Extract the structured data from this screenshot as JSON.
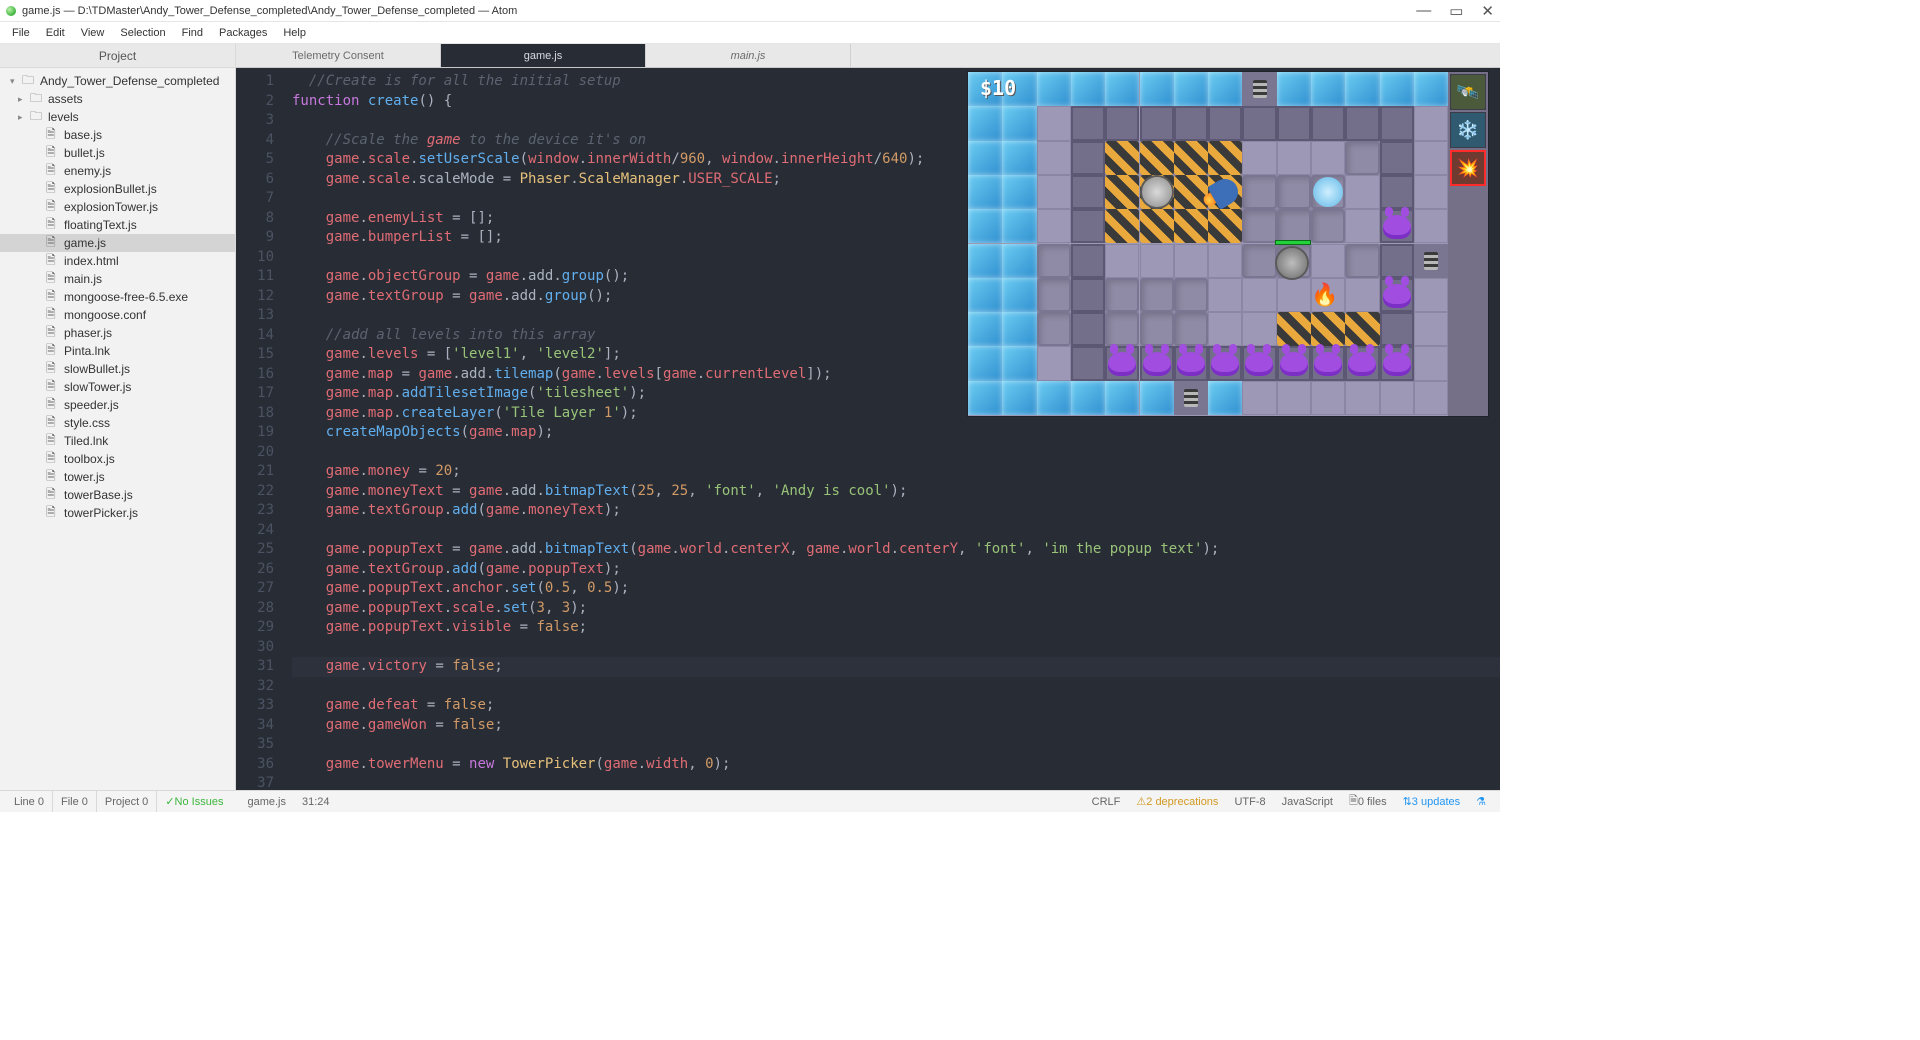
{
  "window": {
    "title": "game.js — D:\\TDMaster\\Andy_Tower_Defense_completed\\Andy_Tower_Defense_completed — Atom"
  },
  "menu": [
    "File",
    "Edit",
    "View",
    "Selection",
    "Find",
    "Packages",
    "Help"
  ],
  "window_controls": {
    "min": "—",
    "max": "▭",
    "close": "✕"
  },
  "sidebar": {
    "title": "Project",
    "root": "Andy_Tower_Defense_completed",
    "folders": [
      "assets",
      "levels"
    ],
    "files": [
      "base.js",
      "bullet.js",
      "enemy.js",
      "explosionBullet.js",
      "explosionTower.js",
      "floatingText.js",
      "game.js",
      "index.html",
      "main.js",
      "mongoose-free-6.5.exe",
      "mongoose.conf",
      "phaser.js",
      "Pinta.lnk",
      "slowBullet.js",
      "slowTower.js",
      "speeder.js",
      "style.css",
      "Tiled.lnk",
      "toolbox.js",
      "tower.js",
      "towerBase.js",
      "towerPicker.js"
    ],
    "selected": "game.js"
  },
  "tabs": [
    {
      "label": "Telemetry Consent",
      "active": false,
      "italic": false
    },
    {
      "label": "game.js",
      "active": true,
      "italic": false
    },
    {
      "label": "main.js",
      "active": false,
      "italic": true
    }
  ],
  "editor": {
    "first_line": 1,
    "highlighted_line": 31,
    "cursor": "31:24"
  },
  "status": {
    "line": "Line 0",
    "file": "File 0",
    "project": "Project 0",
    "issues": "No Issues",
    "filename": "game.js",
    "cursor": "31:24",
    "eol": "CRLF",
    "deprecations": "2 deprecations",
    "encoding": "UTF-8",
    "language": "JavaScript",
    "git_files": "0 files",
    "updates": "3 updates"
  },
  "game_preview": {
    "money": "$10"
  },
  "code_lines": [
    "  //Create is for all the initial setup",
    "function create() {",
    "",
    "    //Scale the game to the device it's on",
    "    game.scale.setUserScale(window.innerWidth/960, window.innerHeight/640);",
    "    game.scale.scaleMode = Phaser.ScaleManager.USER_SCALE;",
    "",
    "    game.enemyList = [];",
    "    game.bumperList = [];",
    "",
    "    game.objectGroup = game.add.group();",
    "    game.textGroup = game.add.group();",
    "",
    "    //add all levels into this array",
    "    game.levels = ['level1', 'level2'];",
    "    game.map = game.add.tilemap(game.levels[game.currentLevel]);",
    "    game.map.addTilesetImage('tilesheet');",
    "    game.map.createLayer('Tile Layer 1');",
    "    createMapObjects(game.map);",
    "",
    "    game.money = 20;",
    "    game.moneyText = game.add.bitmapText(25, 25, 'font', 'Andy is cool');",
    "    game.textGroup.add(game.moneyText);",
    "",
    "    game.popupText = game.add.bitmapText(game.world.centerX, game.world.centerY, 'font', 'im the popup text');",
    "    game.textGroup.add(game.popupText);",
    "    game.popupText.anchor.set(0.5, 0.5);",
    "    game.popupText.scale.set(3, 3);",
    "    game.popupText.visible = false;",
    "",
    "    game.victory = false;",
    "    game.defeat = false;",
    "    game.gameWon = false;",
    "",
    "    game.towerMenu = new TowerPicker(game.width, 0);",
    "",
    "  }"
  ]
}
